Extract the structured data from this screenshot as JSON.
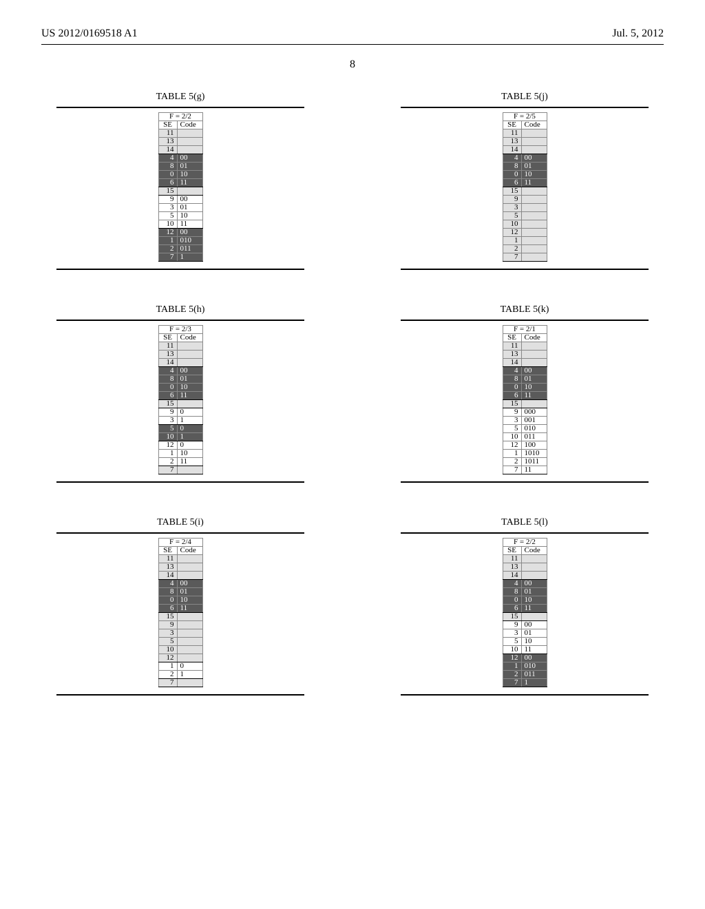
{
  "header": {
    "patent_number": "US 2012/0169518 A1",
    "date": "Jul. 5, 2012",
    "page_number": "8"
  },
  "columns_header": {
    "se": "SE",
    "code": "Code"
  },
  "tables": {
    "g": {
      "caption": "TABLE 5(g)",
      "title": "F = 2/2",
      "groups": [
        {
          "dark": false,
          "shaded": true,
          "rows": [
            {
              "se": "11",
              "code": ""
            },
            {
              "se": "13",
              "code": ""
            },
            {
              "se": "14",
              "code": ""
            }
          ]
        },
        {
          "dark": true,
          "rows": [
            {
              "se": "4",
              "code": "00"
            },
            {
              "se": "8",
              "code": "01"
            },
            {
              "se": "0",
              "code": "10"
            },
            {
              "se": "6",
              "code": "11"
            }
          ]
        },
        {
          "dark": false,
          "shaded": true,
          "rows": [
            {
              "se": "15",
              "code": ""
            }
          ]
        },
        {
          "dark": false,
          "rows": [
            {
              "se": "9",
              "code": "00"
            },
            {
              "se": "3",
              "code": "01"
            },
            {
              "se": "5",
              "code": "10"
            },
            {
              "se": "10",
              "code": "11"
            }
          ]
        },
        {
          "dark": true,
          "rows": [
            {
              "se": "12",
              "code": "00"
            },
            {
              "se": "1",
              "code": "010"
            },
            {
              "se": "2",
              "code": "011"
            },
            {
              "se": "7",
              "code": "1"
            }
          ]
        }
      ]
    },
    "h": {
      "caption": "TABLE 5(h)",
      "title": "F = 2/3",
      "groups": [
        {
          "dark": false,
          "shaded": true,
          "rows": [
            {
              "se": "11",
              "code": ""
            },
            {
              "se": "13",
              "code": ""
            },
            {
              "se": "14",
              "code": ""
            }
          ]
        },
        {
          "dark": true,
          "rows": [
            {
              "se": "4",
              "code": "00"
            },
            {
              "se": "8",
              "code": "01"
            },
            {
              "se": "0",
              "code": "10"
            },
            {
              "se": "6",
              "code": "11"
            }
          ]
        },
        {
          "dark": false,
          "shaded": true,
          "rows": [
            {
              "se": "15",
              "code": ""
            }
          ]
        },
        {
          "dark": false,
          "rows": [
            {
              "se": "9",
              "code": "0"
            },
            {
              "se": "3",
              "code": "1"
            }
          ]
        },
        {
          "dark": true,
          "rows": [
            {
              "se": "5",
              "code": "0"
            },
            {
              "se": "10",
              "code": "1"
            }
          ]
        },
        {
          "dark": false,
          "rows": [
            {
              "se": "12",
              "code": "0"
            },
            {
              "se": "1",
              "code": "10"
            },
            {
              "se": "2",
              "code": "11"
            }
          ]
        },
        {
          "dark": false,
          "shaded": true,
          "rows": [
            {
              "se": "7",
              "code": ""
            }
          ]
        }
      ]
    },
    "i": {
      "caption": "TABLE 5(i)",
      "title": "F = 2/4",
      "groups": [
        {
          "dark": false,
          "shaded": true,
          "rows": [
            {
              "se": "11",
              "code": ""
            },
            {
              "se": "13",
              "code": ""
            },
            {
              "se": "14",
              "code": ""
            }
          ]
        },
        {
          "dark": true,
          "rows": [
            {
              "se": "4",
              "code": "00"
            },
            {
              "se": "8",
              "code": "01"
            },
            {
              "se": "0",
              "code": "10"
            },
            {
              "se": "6",
              "code": "11"
            }
          ]
        },
        {
          "dark": false,
          "shaded": true,
          "rows": [
            {
              "se": "15",
              "code": ""
            },
            {
              "se": "9",
              "code": ""
            },
            {
              "se": "3",
              "code": ""
            },
            {
              "se": "5",
              "code": ""
            },
            {
              "se": "10",
              "code": ""
            },
            {
              "se": "12",
              "code": ""
            }
          ]
        },
        {
          "dark": false,
          "rows": [
            {
              "se": "1",
              "code": "0"
            },
            {
              "se": "2",
              "code": "1"
            }
          ]
        },
        {
          "dark": false,
          "shaded": true,
          "rows": [
            {
              "se": "7",
              "code": ""
            }
          ]
        }
      ]
    },
    "j": {
      "caption": "TABLE 5(j)",
      "title": "F = 2/5",
      "groups": [
        {
          "dark": false,
          "shaded": true,
          "rows": [
            {
              "se": "11",
              "code": ""
            },
            {
              "se": "13",
              "code": ""
            },
            {
              "se": "14",
              "code": ""
            }
          ]
        },
        {
          "dark": true,
          "rows": [
            {
              "se": "4",
              "code": "00"
            },
            {
              "se": "8",
              "code": "01"
            },
            {
              "se": "0",
              "code": "10"
            },
            {
              "se": "6",
              "code": "11"
            }
          ]
        },
        {
          "dark": false,
          "shaded": true,
          "rows": [
            {
              "se": "15",
              "code": ""
            },
            {
              "se": "9",
              "code": ""
            },
            {
              "se": "3",
              "code": ""
            },
            {
              "se": "5",
              "code": ""
            },
            {
              "se": "10",
              "code": ""
            },
            {
              "se": "12",
              "code": ""
            },
            {
              "se": "1",
              "code": ""
            },
            {
              "se": "2",
              "code": ""
            },
            {
              "se": "7",
              "code": ""
            }
          ]
        }
      ]
    },
    "k": {
      "caption": "TABLE 5(k)",
      "title": "F = 2/1",
      "groups": [
        {
          "dark": false,
          "shaded": true,
          "rows": [
            {
              "se": "11",
              "code": ""
            },
            {
              "se": "13",
              "code": ""
            },
            {
              "se": "14",
              "code": ""
            }
          ]
        },
        {
          "dark": true,
          "rows": [
            {
              "se": "4",
              "code": "00"
            },
            {
              "se": "8",
              "code": "01"
            },
            {
              "se": "0",
              "code": "10"
            },
            {
              "se": "6",
              "code": "11"
            }
          ]
        },
        {
          "dark": false,
          "shaded": true,
          "rows": [
            {
              "se": "15",
              "code": ""
            }
          ]
        },
        {
          "dark": false,
          "rows": [
            {
              "se": "9",
              "code": "000"
            },
            {
              "se": "3",
              "code": "001"
            },
            {
              "se": "5",
              "code": "010"
            },
            {
              "se": "10",
              "code": "011"
            },
            {
              "se": "12",
              "code": "100"
            },
            {
              "se": "1",
              "code": "1010"
            },
            {
              "se": "2",
              "code": "1011"
            },
            {
              "se": "7",
              "code": "11"
            }
          ]
        }
      ]
    },
    "l": {
      "caption": "TABLE 5(l)",
      "title": "F = 2/2",
      "groups": [
        {
          "dark": false,
          "shaded": true,
          "rows": [
            {
              "se": "11",
              "code": ""
            },
            {
              "se": "13",
              "code": ""
            },
            {
              "se": "14",
              "code": ""
            }
          ]
        },
        {
          "dark": true,
          "rows": [
            {
              "se": "4",
              "code": "00"
            },
            {
              "se": "8",
              "code": "01"
            },
            {
              "se": "0",
              "code": "10"
            },
            {
              "se": "6",
              "code": "11"
            }
          ]
        },
        {
          "dark": false,
          "shaded": true,
          "rows": [
            {
              "se": "15",
              "code": ""
            }
          ]
        },
        {
          "dark": false,
          "rows": [
            {
              "se": "9",
              "code": "00"
            },
            {
              "se": "3",
              "code": "01"
            },
            {
              "se": "5",
              "code": "10"
            },
            {
              "se": "10",
              "code": "11"
            }
          ]
        },
        {
          "dark": true,
          "rows": [
            {
              "se": "12",
              "code": "00"
            },
            {
              "se": "1",
              "code": "010"
            },
            {
              "se": "2",
              "code": "011"
            },
            {
              "se": "7",
              "code": "1"
            }
          ]
        }
      ]
    }
  },
  "layout": {
    "left_order": [
      "g",
      "h",
      "i"
    ],
    "right_order": [
      "j",
      "k",
      "l"
    ]
  }
}
